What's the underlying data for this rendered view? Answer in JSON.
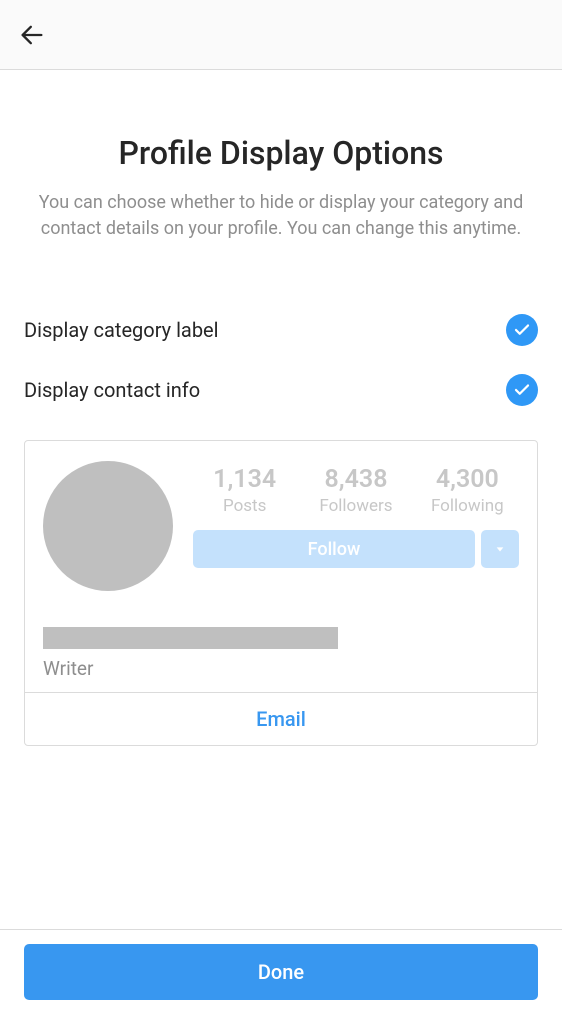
{
  "header": {
    "title": "Profile Display Options",
    "subtitle": "You can choose whether to hide or display your category and contact details on your profile. You can change this anytime."
  },
  "options": {
    "category": {
      "label": "Display category label",
      "checked": true
    },
    "contact": {
      "label": "Display contact info",
      "checked": true
    }
  },
  "preview": {
    "stats": {
      "posts": {
        "value": "1,134",
        "label": "Posts"
      },
      "followers": {
        "value": "8,438",
        "label": "Followers"
      },
      "following": {
        "value": "4,300",
        "label": "Following"
      }
    },
    "follow_label": "Follow",
    "category": "Writer",
    "contact_button": "Email"
  },
  "footer": {
    "done_label": "Done"
  }
}
